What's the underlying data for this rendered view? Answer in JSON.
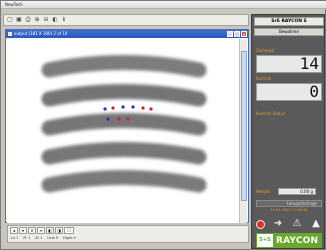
{
  "app": {
    "title": "NewTech",
    "panel_title": "SrS RAYCON S",
    "panel_subtitle": "Bewahren"
  },
  "toolbar": {
    "items": [
      {
        "name": "new-icon",
        "glyph": "▢"
      },
      {
        "name": "open-icon",
        "glyph": "▣"
      },
      {
        "name": "print-icon",
        "glyph": "⎙"
      },
      {
        "name": "zoom-in-icon",
        "glyph": "⊕"
      },
      {
        "name": "zoom-out-icon",
        "glyph": "⊖"
      },
      {
        "name": "contrast-icon",
        "glyph": "◐"
      },
      {
        "name": "info-icon",
        "glyph": "ℹ"
      }
    ]
  },
  "image_window": {
    "title": "output (381 X 300) 2 of 10"
  },
  "navbar": {
    "buttons": [
      "◂",
      "▾",
      "✕",
      "≡",
      "◧",
      "◨"
    ],
    "field_value": "10",
    "info": [
      "Lv 1",
      "Pr 1",
      "Zr 1",
      "Line 9",
      "Hight 0"
    ]
  },
  "panel": {
    "label_top": "Zeitstuck",
    "counter_top": "14",
    "label_second": "Kontroll",
    "counter_second": "0",
    "label_status": "Kontroll Status",
    "weight_label": "Weight",
    "weight_value": "0.00 g",
    "button_text": "Fotogs/Anfrage",
    "timestamp": "14.01.2005 11:28:38",
    "logo_badge": "S+S",
    "logo_text": "RAYCON"
  },
  "colors": {
    "accent_orange": "#e39a2a",
    "brand_green": "#6aa82c",
    "panel_dark": "#5a5a5a"
  }
}
